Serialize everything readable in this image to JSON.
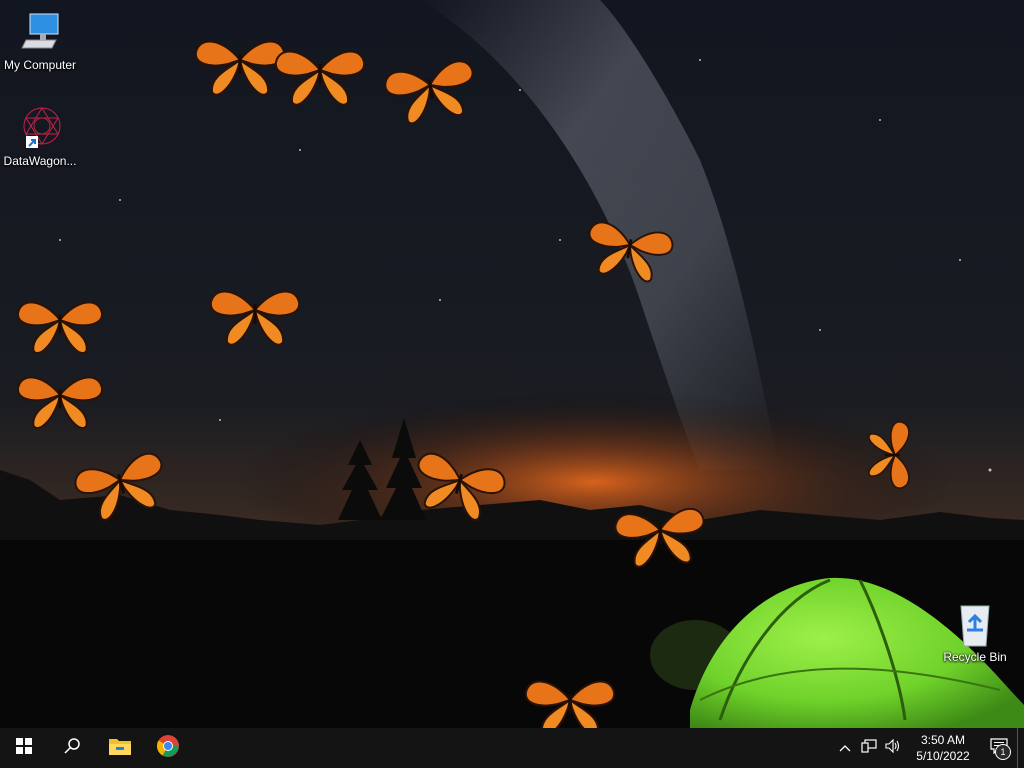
{
  "desktop": {
    "icons": [
      {
        "label": "My Computer",
        "icon": "monitor-icon"
      },
      {
        "label": "DataWagon...",
        "icon": "datawagon-shortcut-icon"
      },
      {
        "label": "Recycle Bin",
        "icon": "recycle-bin-icon"
      }
    ],
    "wallpaper": {
      "description_icons": [
        "milky-way",
        "tent",
        "butterflies"
      ],
      "sky_color": "#0f1218",
      "glow_color": "#e0661c",
      "tent_color": "#6fd22a"
    }
  },
  "taskbar": {
    "apps": [
      {
        "icon": "windows-start-icon"
      },
      {
        "icon": "search-icon"
      },
      {
        "icon": "file-explorer-icon"
      },
      {
        "icon": "chrome-icon"
      }
    ],
    "tray": {
      "icons": [
        "chevron-up-icon",
        "network-icon",
        "volume-icon"
      ],
      "time": "3:50 AM",
      "date": "5/10/2022",
      "notification_count": "1"
    }
  }
}
